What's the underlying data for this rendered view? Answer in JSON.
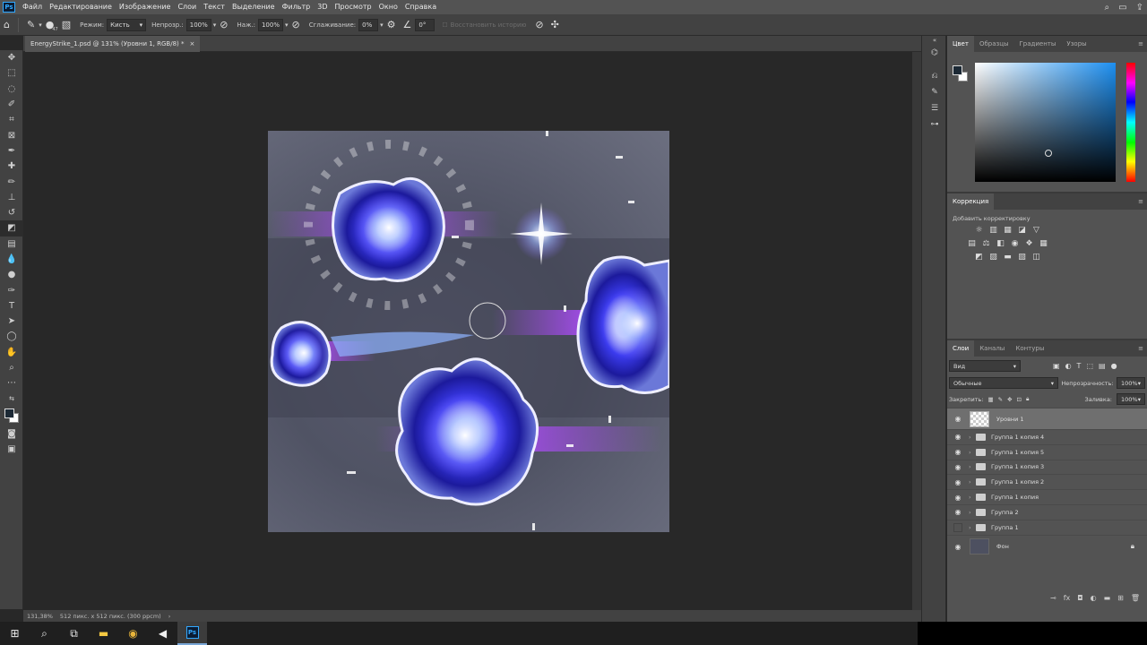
{
  "menubar": {
    "logo": "Ps",
    "items": [
      "Файл",
      "Редактирование",
      "Изображение",
      "Слои",
      "Текст",
      "Выделение",
      "Фильтр",
      "3D",
      "Просмотр",
      "Окно",
      "Справка"
    ]
  },
  "options": {
    "brush_size": "47",
    "mode_label": "Режим:",
    "mode_value": "Кисть",
    "opacity_label": "Непрозр.:",
    "opacity_value": "100%",
    "pressure_label": "Наж.:",
    "pressure_value": "100%",
    "smoothing_label": "Сглаживание:",
    "smoothing_value": "0%",
    "angle_value": "0°",
    "erase_history": "Восстановить историю"
  },
  "document": {
    "tab_title": "EnergyStrike_1.psd @ 131% (Уровни 1, RGB/8) *",
    "close": "×"
  },
  "status": {
    "zoom": "131,38%",
    "size": "512 пикс. x 512 пикс. (300 ppcm)",
    "arrow": "›"
  },
  "panels": {
    "color_tabs": [
      "Цвет",
      "Образцы",
      "Градиенты",
      "Узоры"
    ],
    "adj_tab": "Коррекция",
    "adj_add": "Добавить корректировку",
    "layer_tabs": [
      "Слои",
      "Каналы",
      "Контуры"
    ],
    "filter": "Вид",
    "blend": "Обычные",
    "opacity_label": "Непрозрачность:",
    "opacity_value": "100%",
    "lock_label": "Закрепить:",
    "fill_label": "Заливка:",
    "fill_value": "100%"
  },
  "layers": [
    {
      "name": "Уровни 1",
      "visible": true,
      "type": "adjustment",
      "selected": true
    },
    {
      "name": "Группа 1 копия 4",
      "visible": true,
      "type": "group"
    },
    {
      "name": "Группа 1 копия 5",
      "visible": true,
      "type": "group"
    },
    {
      "name": "Группа 1 копия 3",
      "visible": true,
      "type": "group"
    },
    {
      "name": "Группа 1 копия 2",
      "visible": true,
      "type": "group"
    },
    {
      "name": "Группа 1 копия",
      "visible": true,
      "type": "group"
    },
    {
      "name": "Группа 2",
      "visible": true,
      "type": "group"
    },
    {
      "name": "Группа 1",
      "visible": false,
      "type": "group"
    },
    {
      "name": "Фон",
      "visible": true,
      "type": "background",
      "locked": true
    }
  ],
  "colors": {
    "foreground": "#1c2935",
    "background": "#ffffff",
    "accent": "#31a8ff"
  }
}
